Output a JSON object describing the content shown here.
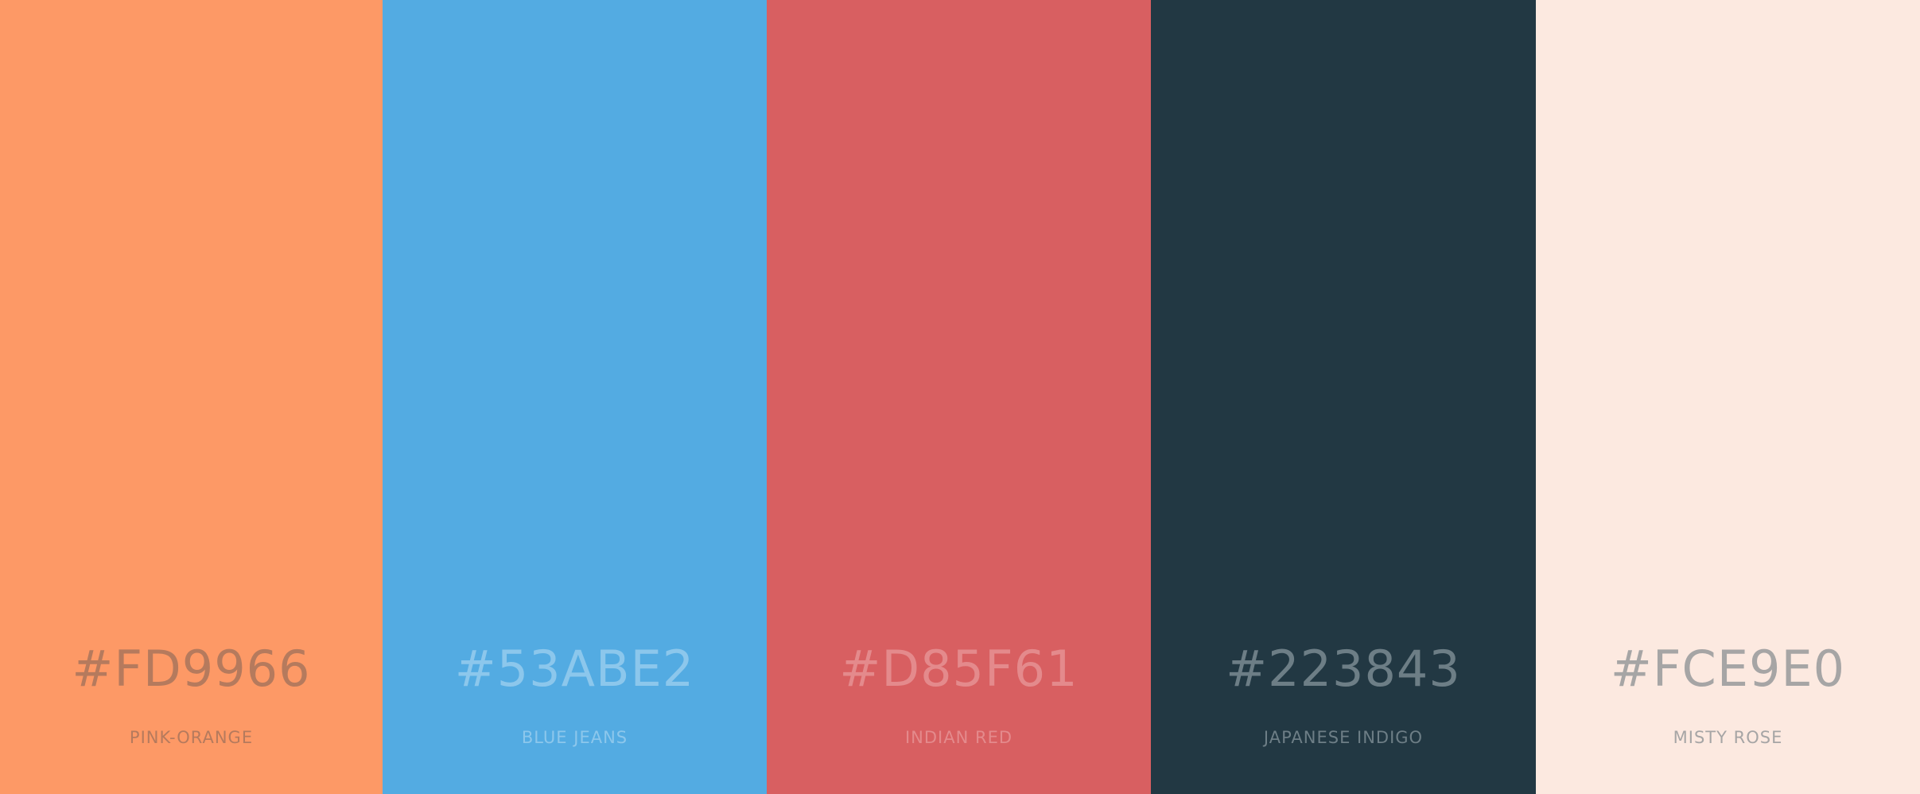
{
  "swatches": [
    {
      "hex": "#FD9966",
      "name": "PINK-ORANGE",
      "color": "#FD9966",
      "text_color": "#B57A5D"
    },
    {
      "hex": "#53ABE2",
      "name": "BLUE JEANS",
      "color": "#53ABE2",
      "text_color": "#8CC7EC"
    },
    {
      "hex": "#D85F61",
      "name": "INDIAN RED",
      "color": "#D85F61",
      "text_color": "#E48A8C"
    },
    {
      "hex": "#223843",
      "name": "JAPANESE INDIGO",
      "color": "#223843",
      "text_color": "#6D7E86"
    },
    {
      "hex": "#FCE9E0",
      "name": "MISTY ROSE",
      "color": "#FCE9E0",
      "text_color": "#A6A5A5"
    }
  ]
}
